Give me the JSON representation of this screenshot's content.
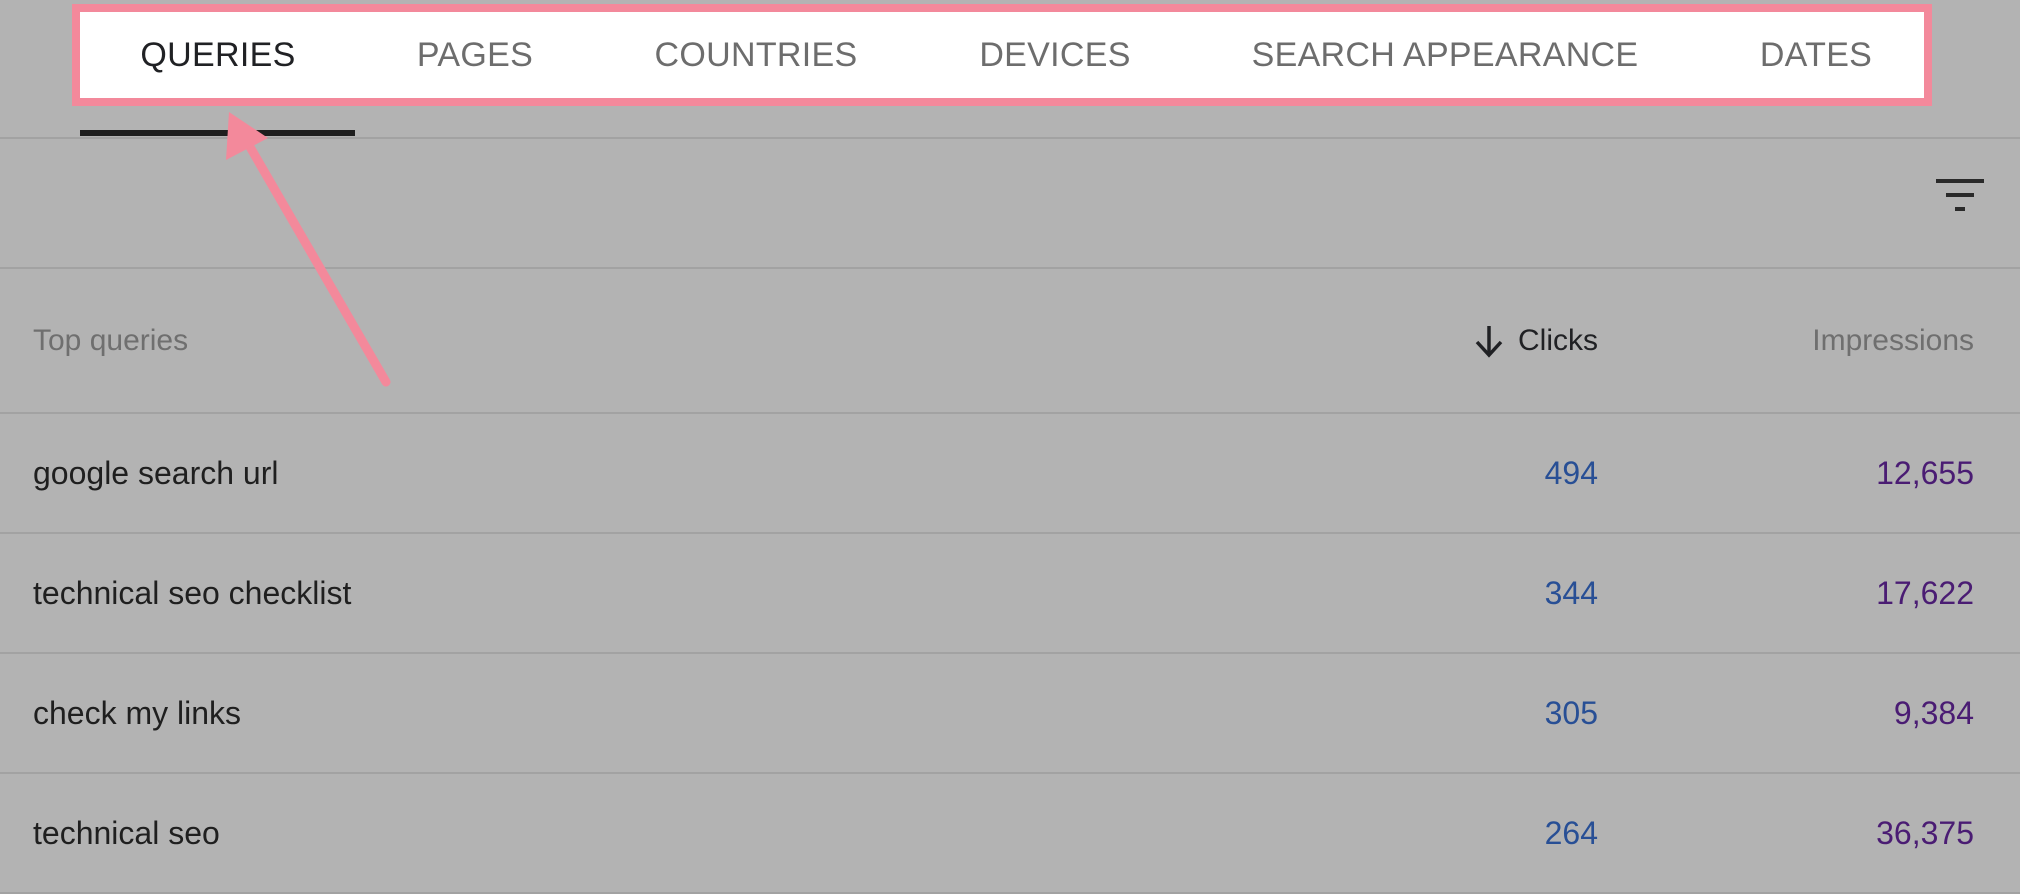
{
  "tabs": [
    {
      "label": "QUERIES",
      "active": true
    },
    {
      "label": "PAGES",
      "active": false
    },
    {
      "label": "COUNTRIES",
      "active": false
    },
    {
      "label": "DEVICES",
      "active": false
    },
    {
      "label": "SEARCH APPEARANCE",
      "active": false
    },
    {
      "label": "DATES",
      "active": false
    }
  ],
  "filter": {
    "icon": "filter-icon"
  },
  "table": {
    "headers": {
      "query": "Top queries",
      "clicks": "Clicks",
      "impressions": "Impressions"
    },
    "sort_icon": "arrow-down-icon",
    "rows": [
      {
        "query": "google search url",
        "clicks": "494",
        "impressions": "12,655"
      },
      {
        "query": "technical seo checklist",
        "clicks": "344",
        "impressions": "17,622"
      },
      {
        "query": "check my links",
        "clicks": "305",
        "impressions": "9,384"
      },
      {
        "query": "technical seo",
        "clicks": "264",
        "impressions": "36,375"
      }
    ]
  },
  "colors": {
    "highlight": "#f3899b",
    "clicks": "#284f95",
    "impressions": "#4a1c73",
    "background": "#b3b3b3"
  }
}
